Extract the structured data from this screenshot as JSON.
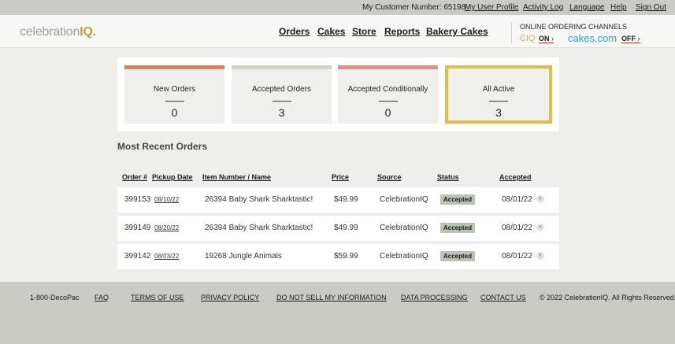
{
  "topbar": {
    "customer_label": "My Customer Number: 65198",
    "links": [
      "My User Profile",
      "Activity Log",
      "Language",
      "Help",
      "Sign Out"
    ]
  },
  "header": {
    "logo": {
      "part1": "celebration",
      "part2": "IQ",
      "dot": "."
    },
    "nav": [
      "Orders",
      "Cakes",
      "Store",
      "Reports",
      "Bakery Cakes"
    ],
    "channels": {
      "title": "ONLINE ORDERING CHANNELS",
      "ciq_logo": "CIQ",
      "ciq_state": "ON",
      "cakes_logo": "cakes.com",
      "cakes_state": "OFF",
      "chevron": "›"
    }
  },
  "summary_cards": [
    {
      "label": "New Orders",
      "count": "0",
      "color": "#e97a56"
    },
    {
      "label": "Accepted Orders",
      "count": "3",
      "color": "#cdd5c8"
    },
    {
      "label": "Accepted Conditionally",
      "count": "0",
      "color": "#f28a7d"
    },
    {
      "label": "All Active",
      "count": "3",
      "color": "#e5bd45"
    }
  ],
  "recent_orders": {
    "title": "Most Recent Orders",
    "columns": [
      "Order #",
      "Pickup Date",
      "Item Number / Name",
      "Price",
      "Source",
      "Status",
      "Accepted"
    ],
    "rows": [
      {
        "order": "399153",
        "pickup": "08/10/22",
        "item": "26394 Baby Shark Sharktastic!",
        "price": "$49.99",
        "source": "CelebrationIQ",
        "status": "Accepted",
        "accepted": "08/01/22"
      },
      {
        "order": "399149",
        "pickup": "08/20/22",
        "item": "26394 Baby Shark Sharktastic!",
        "price": "$49.99",
        "source": "CelebrationIQ",
        "status": "Accepted",
        "accepted": "08/01/22"
      },
      {
        "order": "399142",
        "pickup": "08/03/22",
        "item": "19268 Jungle Animals",
        "price": "$59.99",
        "source": "CelebrationIQ",
        "status": "Accepted",
        "accepted": "08/01/22"
      }
    ]
  },
  "footer": {
    "phone": "1-800-DecoPac",
    "links": [
      "FAQ",
      "TERMS OF USE",
      "PRIVACY POLICY",
      "DO NOT SELL MY INFORMATION",
      "DATA PROCESSING",
      "CONTACT US"
    ],
    "copyright": "© 2022 CelebrationIQ. All Rights Reserved."
  }
}
